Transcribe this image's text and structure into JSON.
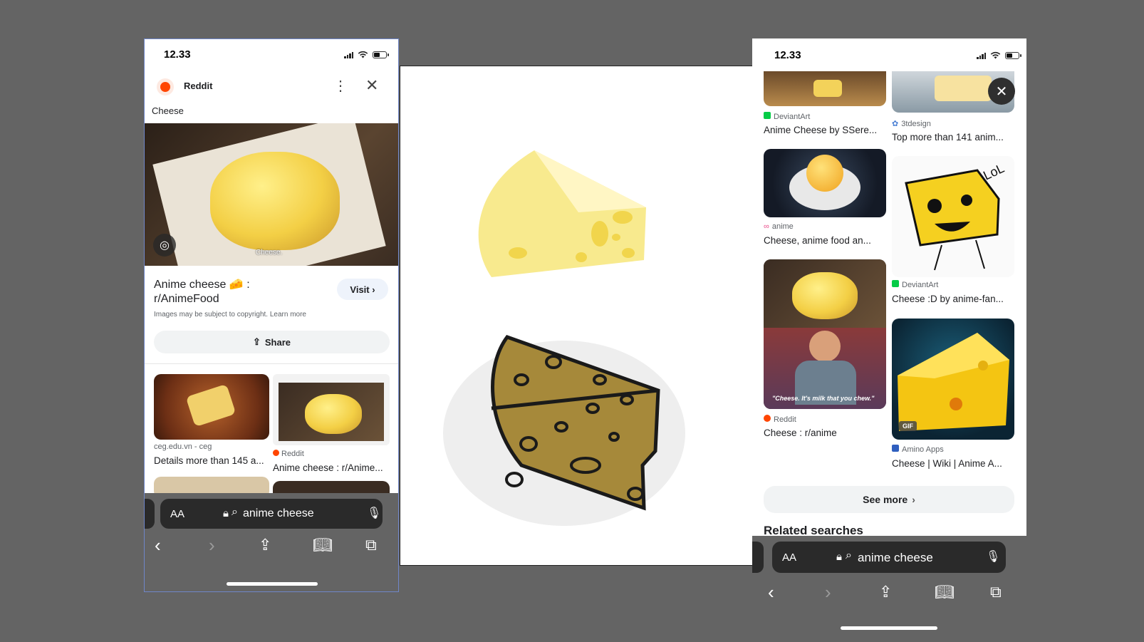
{
  "left_phone": {
    "status": {
      "time": "12.33"
    },
    "header": {
      "site": "Reddit"
    },
    "title_small": "Cheese",
    "hero_watermark": "Cheese.",
    "result": {
      "title_line1": "Anime cheese 🧀 :",
      "title_line2": "r/AnimeFood",
      "visit_label": "Visit ›",
      "copyright_note": "Images may be subject to copyright. Learn more"
    },
    "share_label": "Share",
    "grid": [
      {
        "source": "ceg.edu.vn - ceg",
        "caption": "Details more than 145 a..."
      },
      {
        "source": "Reddit",
        "caption": "Anime cheese : r/Anime..."
      }
    ],
    "urlbar": {
      "aa": "AA",
      "query": "anime cheese"
    }
  },
  "right_phone": {
    "status": {
      "time": "12.33"
    },
    "results": [
      {
        "source": "DeviantArt",
        "caption": "Anime Cheese by SSere..."
      },
      {
        "source": "3tdesign",
        "caption": "Top more than 141 anim..."
      },
      {
        "source": "anime",
        "caption": "Cheese, anime food an..."
      },
      {
        "source": "DeviantArt",
        "caption": "Cheese :D by anime-fan..."
      },
      {
        "source": "Reddit",
        "caption": "Cheese : r/anime"
      },
      {
        "source": "Amino Apps",
        "caption": "Cheese | Wiki | Anime A..."
      }
    ],
    "friends_subtitle": "\"Cheese. It's milk that you chew.\"",
    "lol_text": "LoL",
    "gif_badge": "GIF",
    "see_more_label": "See more",
    "related_heading": "Related searches",
    "urlbar": {
      "aa": "AA",
      "query": "anime cheese"
    }
  },
  "colors": {
    "background": "#646464",
    "reddit_orange": "#ff4500",
    "cheese_yellow": "#f5d54a"
  }
}
